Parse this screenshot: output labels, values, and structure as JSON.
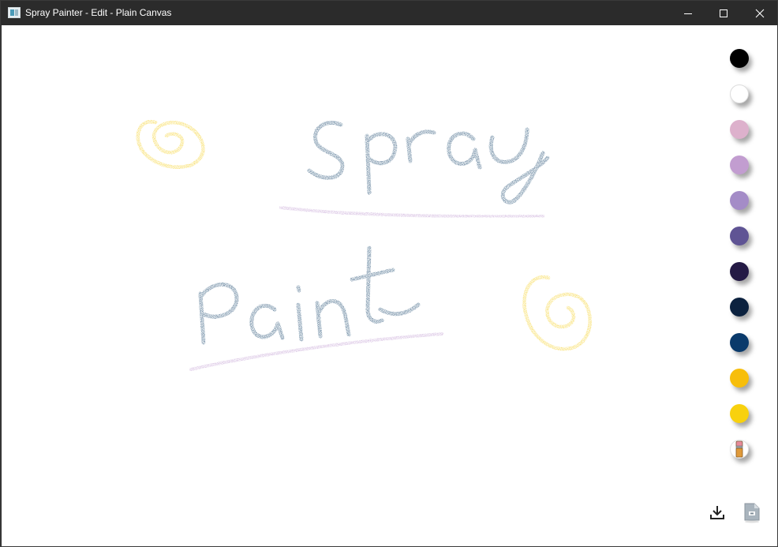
{
  "window": {
    "title": "Spray Painter - Edit - Plain Canvas"
  },
  "titlebar_buttons": {
    "minimize_icon": "minimize-icon",
    "maximize_icon": "maximize-icon",
    "close_icon": "close-icon"
  },
  "canvas": {
    "text_strokes": [
      "Spray",
      "Paint"
    ],
    "colors": {
      "text": "#0e3a63",
      "underline": "#bf9ad0",
      "swirl": "#f4cc14"
    }
  },
  "palette": {
    "colors": [
      "#000000",
      "#ffffff",
      "#ddb1cc",
      "#c29dd0",
      "#a48cc7",
      "#5f5494",
      "#241a45",
      "#0c223f",
      "#0a3a6b",
      "#f7be0b",
      "#f8d10e"
    ],
    "eraser_icon": "eraser-icon"
  },
  "actions": {
    "save_icon": "download-icon",
    "file_icon": "file-icon"
  }
}
